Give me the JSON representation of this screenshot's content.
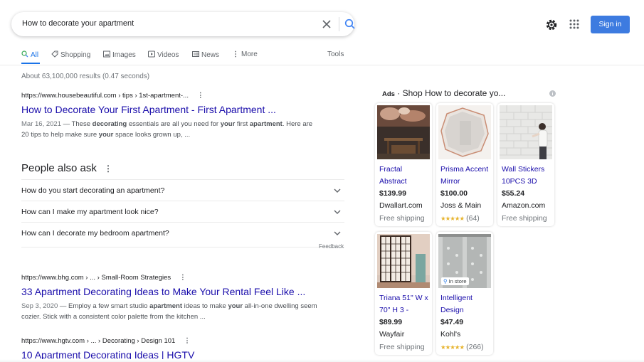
{
  "search": {
    "query": "How to decorate your apartment",
    "icons": [
      "close-icon",
      "search-icon"
    ]
  },
  "header": {
    "signin_label": "Sign in",
    "signin_color": "#3d7be0",
    "icons": [
      "gear-icon",
      "apps-grid-icon"
    ]
  },
  "tabs": {
    "items": [
      {
        "label": "All",
        "icon": "search-icon",
        "active": true
      },
      {
        "label": "Shopping",
        "icon": "tag-icon"
      },
      {
        "label": "Images",
        "icon": "image-icon"
      },
      {
        "label": "Videos",
        "icon": "play-icon"
      },
      {
        "label": "News",
        "icon": "news-icon"
      },
      {
        "label": "More",
        "icon": "kebab-icon"
      }
    ],
    "tools_label": "Tools",
    "accent_color": "#1a73e8"
  },
  "stats": "About 63,100,000 results (0.47 seconds)",
  "results": [
    {
      "url": "https://www.housebeautiful.com › tips › 1st-apartment-...",
      "title": "How to Decorate Your First Apartment - First Apartment ...",
      "date": "Mar 16, 2021",
      "snippet_parts": [
        " — These ",
        "decorating",
        " essentials are all you need for ",
        "your",
        " first ",
        "apartment",
        ". Here are 20 tips to help make sure ",
        "your",
        " space looks grown up, ..."
      ]
    },
    {
      "url": "https://www.bhg.com › ... › Small-Room Strategies",
      "title": "33 Apartment Decorating Ideas to Make Your Rental Feel Like ...",
      "date": "Sep 3, 2020",
      "snippet_parts": [
        " — Employ a few smart studio ",
        "apartment",
        " ideas to make ",
        "your",
        " all-in-one dwelling seem cozier. Stick with a consistent color palette from the kitchen ..."
      ]
    },
    {
      "url": "https://www.hgtv.com › ... › Decorating › Design 101",
      "title": "10 Apartment Decorating Ideas | HGTV"
    }
  ],
  "people_also_ask": {
    "title": "People also ask",
    "questions": [
      "How do you start decorating an apartment?",
      "How can I make my apartment look nice?",
      "How can I decorate my bedroom apartment?"
    ],
    "feedback_label": "Feedback"
  },
  "ads": {
    "label": "Ads",
    "heading": " · Shop How to decorate yo...",
    "products": [
      {
        "name": "Fractal Abstract",
        "price": "$139.99",
        "seller": "Dwallart.com",
        "extra": "Free shipping"
      },
      {
        "name": "Prisma Accent Mirror",
        "price": "$100.00",
        "seller": "Joss & Main",
        "rating_count": "(64)",
        "stars": "★★★★★"
      },
      {
        "name": "Wall Stickers 10PCS 3D",
        "price": "$55.24",
        "seller": "Amazon.com",
        "extra": "Free shipping"
      },
      {
        "name": "Triana 51\" W x 70\" H 3 -",
        "price": "$89.99",
        "seller": "Wayfair",
        "extra": "Free shipping"
      },
      {
        "name": "Intelligent Design",
        "price": "$47.49",
        "seller": "Kohl's",
        "rating_count": "(266)",
        "stars": "★★★★★",
        "badge": "In store"
      }
    ]
  }
}
